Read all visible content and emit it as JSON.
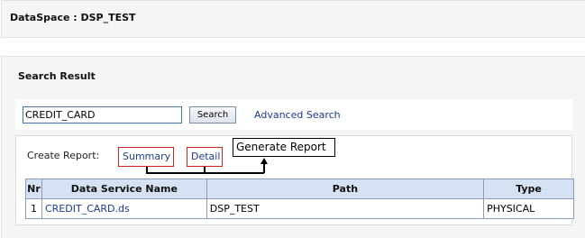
{
  "dataspace": {
    "label": "DataSpace : DSP_TEST"
  },
  "search_result": {
    "title": "Search Result",
    "search_value": "CREDIT_CARD",
    "search_button": "Search",
    "advanced_link": "Advanced Search"
  },
  "report": {
    "create_label": "Create Report:",
    "summary_link": "Summary",
    "detail_link": "Detail",
    "callout": "Generate Report"
  },
  "table": {
    "headers": [
      "Nr",
      "Data Service Name",
      "Path",
      "Type"
    ],
    "rows": [
      {
        "nr": "1",
        "name": "CREDIT_CARD.ds",
        "path": "DSP_TEST",
        "type": "PHYSICAL"
      }
    ]
  }
}
